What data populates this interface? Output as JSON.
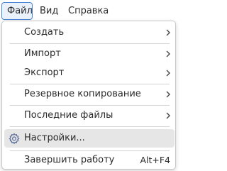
{
  "menubar": {
    "items": [
      {
        "label": "Файл"
      },
      {
        "label": "Вид"
      },
      {
        "label": "Справка"
      }
    ]
  },
  "file_menu": {
    "items": [
      {
        "label": "Создать",
        "submenu": true,
        "icon": ""
      },
      {
        "label": "Импорт",
        "submenu": true,
        "icon": ""
      },
      {
        "label": "Экспорт",
        "submenu": true,
        "icon": ""
      },
      {
        "label": "Резервное копирование",
        "submenu": true,
        "icon": ""
      },
      {
        "label": "Последние файлы",
        "submenu": true,
        "icon": ""
      },
      {
        "label": "Настройки...",
        "submenu": false,
        "icon": "gear-icon",
        "highlighted": true
      },
      {
        "label": "Завершить работу",
        "submenu": false,
        "icon": "",
        "shortcut": "Alt+F4"
      }
    ]
  },
  "colors": {
    "active_border": "#4a84d6",
    "highlight": "#e6e6e6",
    "separator": "#d4d4d4",
    "text": "#2b2b2b"
  }
}
